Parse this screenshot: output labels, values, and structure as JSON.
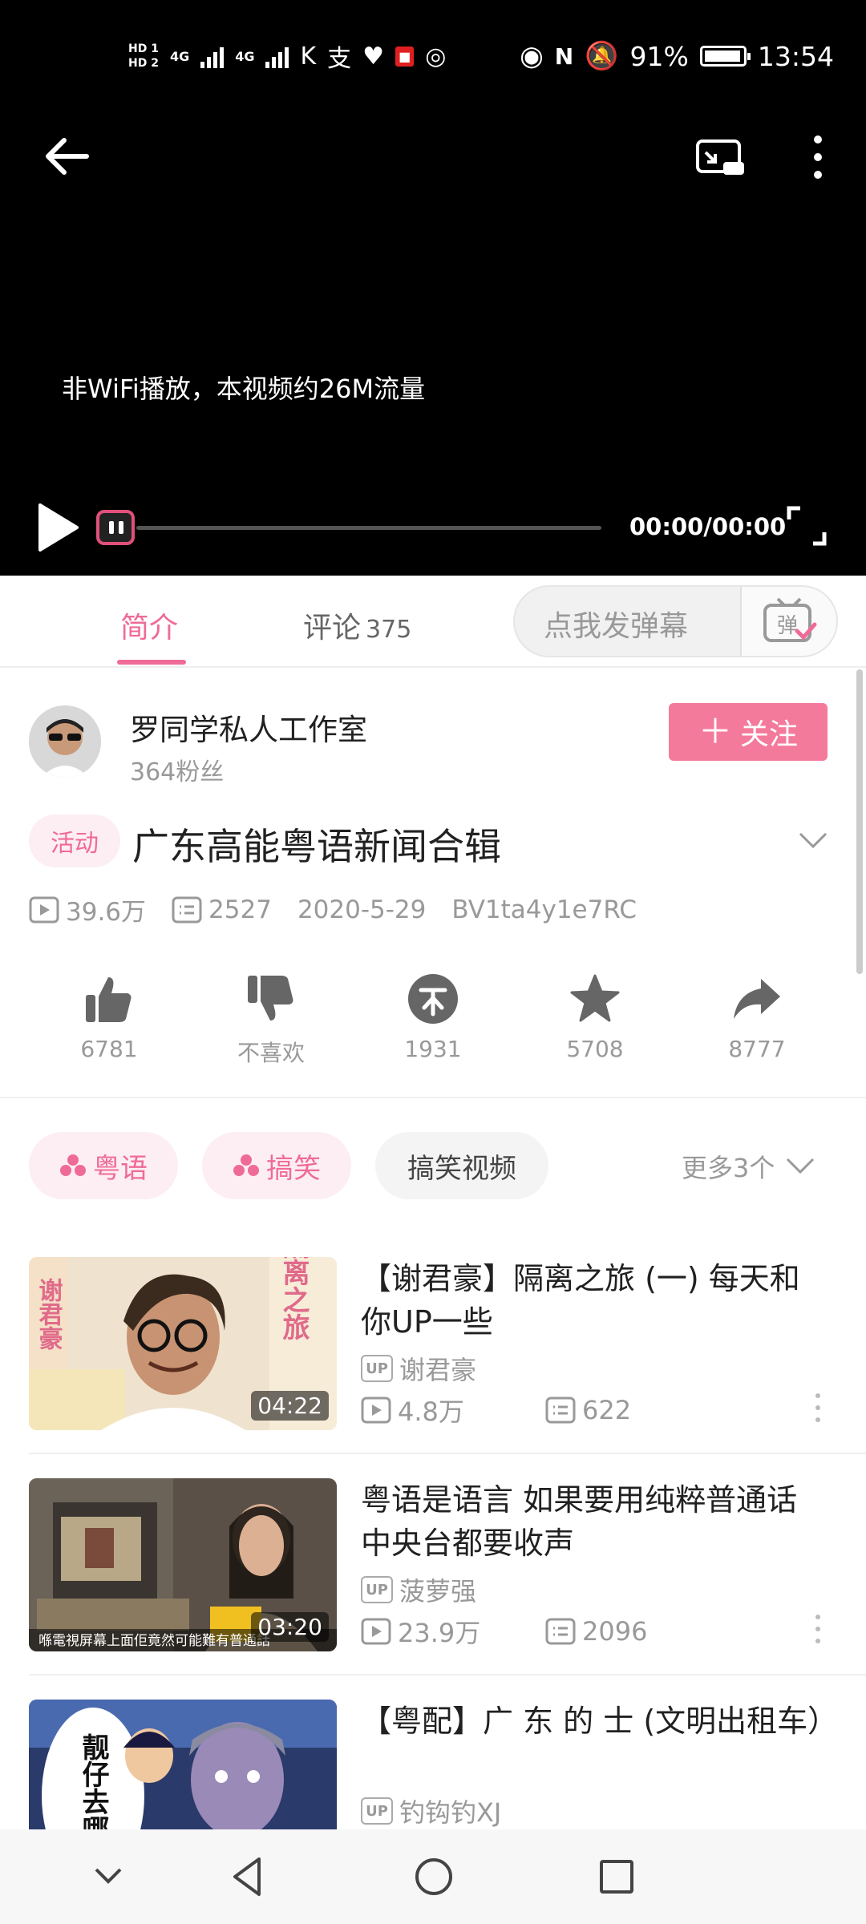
{
  "status_bar": {
    "hd1": "HD 1",
    "hd2": "HD 2",
    "signal1": "4G",
    "signal2": "4G",
    "battery": "91%",
    "time": "13:54"
  },
  "player": {
    "notice": "非WiFi播放，本视频约26M流量",
    "timecode": "00:00/00:00",
    "progress": 0
  },
  "tabs": {
    "intro": "简介",
    "comments": "评论",
    "comments_count": "375",
    "danmaku_placeholder": "点我发弹幕",
    "danmaku_icon_text": "弹"
  },
  "uploader": {
    "name": "罗同学私人工作室",
    "fans": "364粉丝",
    "follow_label": "关注"
  },
  "video": {
    "badge": "活动",
    "title": "广东高能粤语新闻合辑",
    "views": "39.6万",
    "danmaku": "2527",
    "date": "2020-5-29",
    "bvid": "BV1ta4y1e7RC"
  },
  "actions": {
    "like": "6781",
    "dislike": "不喜欢",
    "coin": "1931",
    "favorite": "5708",
    "share": "8777"
  },
  "tags": {
    "items": [
      "粤语",
      "搞笑",
      "搞笑视频"
    ],
    "more": "更多3个"
  },
  "recommendations": [
    {
      "title": "【谢君豪】隔离之旅 (一) 每天和你UP一些",
      "up": "谢君豪",
      "views": "4.8万",
      "danmaku": "622",
      "duration": "04:22",
      "thumb_text": "隔离之旅",
      "thumb_text2": "谢君豪"
    },
    {
      "title": "粤语是语言 如果要用纯粹普通话 中央台都要收声",
      "up": "菠萝强",
      "views": "23.9万",
      "danmaku": "2096",
      "duration": "03:20",
      "thumb_caption": "喺電視屏幕上面佢竟然可能難有普通話"
    },
    {
      "title": "【粤配】广 东 的 士 (文明出租车）",
      "up": "钓钩钓XJ",
      "thumb_text": "靓仔去哪"
    }
  ],
  "up_badge": "UP",
  "colors": {
    "accent": "#ef6b97",
    "follow": "#f47a9b"
  }
}
